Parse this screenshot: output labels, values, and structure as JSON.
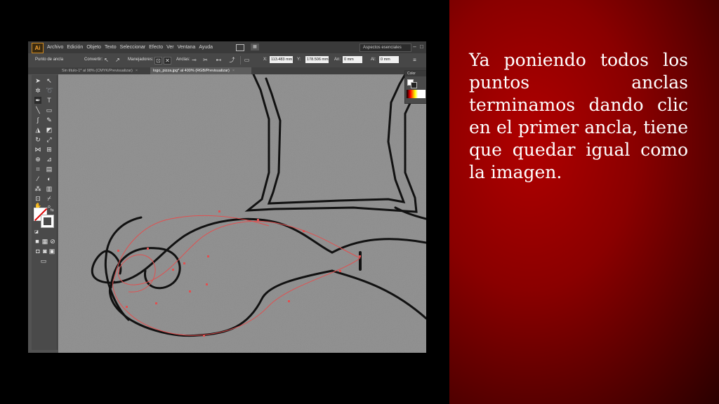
{
  "slide": {
    "caption": "Ya poniendo todos los puntos anclas terminamos dando clic en el primer ancla, tiene que quedar igual como la imagen."
  },
  "app": {
    "logo": "Ai",
    "menu": [
      "Archivo",
      "Edición",
      "Objeto",
      "Texto",
      "Seleccionar",
      "Efecto",
      "Ver",
      "Ventana",
      "Ayuda"
    ],
    "workspace": "Aspectos esenciales",
    "window_buttons": [
      "–",
      "□",
      "✕"
    ],
    "control_bar": {
      "tool_name": "Punto de ancla",
      "convert_label": "Convertir:",
      "handles_label": "Manejadores:",
      "anchors_label": "Anclas:",
      "x_label": "X:",
      "x_value": "113.483 mm",
      "y_label": "Y:",
      "y_value": "178.506 mm",
      "w_label": "An:",
      "w_value": "0 mm",
      "h_label": "Al:",
      "h_value": "0 mm"
    },
    "tabs": [
      {
        "label": "Sin título-1* al 98% (CMYK/Previsualizar)",
        "close": "×"
      },
      {
        "label": "logo_pizza.jpg* al 400% (RGB/Previsualizar)",
        "close": "×"
      }
    ],
    "color_panel": {
      "title": "Color"
    }
  },
  "colors": {
    "slide_background": "#8a0000",
    "canvas": "#8a8a8a",
    "path_stroke": "#e05050",
    "artwork_line": "#111111"
  },
  "icons": [
    "selection-icon",
    "direct-selection-icon",
    "magic-wand-icon",
    "lasso-icon",
    "pen-icon",
    "type-icon",
    "line-icon",
    "rectangle-icon",
    "brush-icon",
    "pencil-icon",
    "blob-brush-icon",
    "eraser-icon",
    "rotate-icon",
    "scale-icon",
    "width-icon",
    "free-transform-icon",
    "shape-builder-icon",
    "perspective-icon",
    "mesh-icon",
    "gradient-icon",
    "eyedropper-icon",
    "blend-icon",
    "symbol-sprayer-icon",
    "graph-icon",
    "artboard-icon",
    "slice-icon",
    "hand-icon",
    "zoom-icon"
  ]
}
